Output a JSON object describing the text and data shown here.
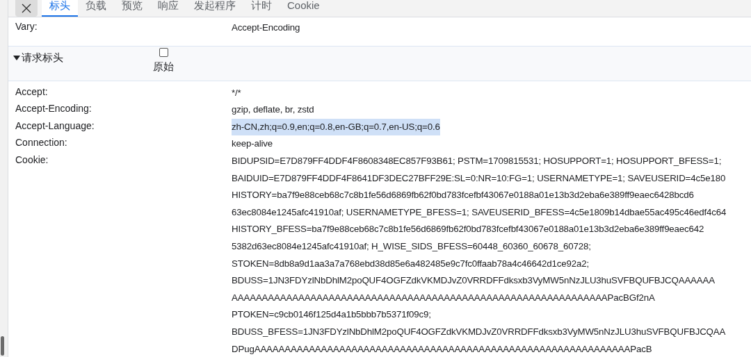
{
  "tabs": [
    {
      "label": "标头",
      "selected": true
    },
    {
      "label": "负载",
      "selected": false
    },
    {
      "label": "预览",
      "selected": false
    },
    {
      "label": "响应",
      "selected": false
    },
    {
      "label": "发起程序",
      "selected": false
    },
    {
      "label": "计时",
      "selected": false
    },
    {
      "label": "Cookie",
      "selected": false
    }
  ],
  "response_headers": [
    {
      "name": "Vary:",
      "value_lines": [
        "Accept-Encoding"
      ],
      "highlighted": false
    }
  ],
  "request_section": {
    "title": "请求标头",
    "expanded": true,
    "raw_toggle": {
      "label": "原始",
      "checked": false
    }
  },
  "request_headers": [
    {
      "name": "Accept:",
      "value_lines": [
        "*/*"
      ],
      "highlighted": false
    },
    {
      "name": "Accept-Encoding:",
      "value_lines": [
        "gzip, deflate, br, zstd"
      ],
      "highlighted": false
    },
    {
      "name": "Accept-Language:",
      "value_lines": [
        "zh-CN,zh;q=0.9,en;q=0.8,en-GB;q=0.7,en-US;q=0.6"
      ],
      "highlighted": true
    },
    {
      "name": "Connection:",
      "value_lines": [
        "keep-alive"
      ],
      "highlighted": false
    },
    {
      "name": "Cookie:",
      "value_lines": [
        "BIDUPSID=E7D879FF4DDF4F8608348EC857F93B61; PSTM=1709815531; HOSUPPORT=1; HOSUPPORT_BFESS=1;",
        "BAIDUID=E7D879FF4DDF4F8641DF3DEC27BFF29E:SL=0:NR=10:FG=1; USERNAMETYPE=1; SAVEUSERID=4c5e180",
        "HISTORY=ba7f9e88ceb68c7c8b1fe56d6869fb62f0bd783fcefbf43067e0188a01e13b3d2eba6e389ff9eaec6428bcd6",
        "63ec8084e1245afc41910af; USERNAMETYPE_BFESS=1; SAVEUSERID_BFESS=4c5e1809b14dbae55ac495c46edf4c64",
        "HISTORY_BFESS=ba7f9e88ceb68c7c8b1fe56d6869fb62f0bd783fcefbf43067e0188a01e13b3d2eba6e389ff9eaec642",
        "5382d63ec8084e1245afc41910af; H_WISE_SIDS_BFESS=60448_60360_60678_60728;",
        "STOKEN=8db8a9d1aa3a7a768ebd38d85e6a482485e9c7fc0ffaab78a4c46642d1ce92a2;",
        "BDUSS=1JN3FDYzlNbDhlM2poQUF4OGFZdkVKMDJvZ0VRRDFFdksxb3VyMW5nNzJLU3huSVFBQUFBJCQAAAAAA",
        "AAAAAAAAAAAAAAAAAAAAAAAAAAAAAAAAAAAAAAAAAAAAAAAAAAAAAAAAAAAAAAPacBGf2nA",
        "PTOKEN=c9cb0146f125d4a1b5bbb7b5371f09c9;",
        "BDUSS_BFESS=1JN3FDYzlNbDhlM2poQUF4OGFZdkVKMDJvZ0VRRDFFdksxb3VyMW5nNzJLU3huSVFBQUFBJCQAA",
        "DPugAAAAAAAAAAAAAAAAAAAAAAAAAAAAAAAAAAAAAAAAAAAAAAAAAAAAAAAAAAAAAAPacB"
      ],
      "highlighted": false
    }
  ]
}
